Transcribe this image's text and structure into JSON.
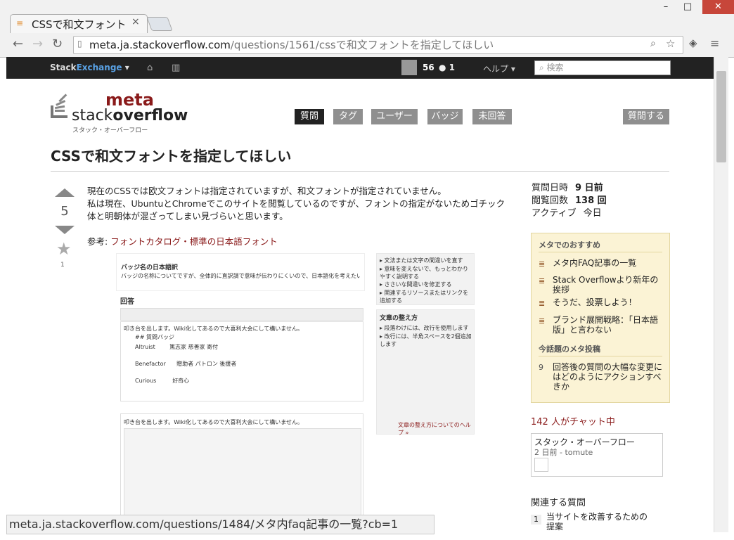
{
  "browser": {
    "tab_title": "CSSで和文フォント",
    "tab_close": "×",
    "url_host": "meta.ja.stackoverflow.com",
    "url_path": "/questions/1561/cssで和文フォントを指定してほしい",
    "status_url": "meta.ja.stackoverflow.com/questions/1484/メタ内faq記事の一覧?cb=1"
  },
  "topbar": {
    "brand_a": "Stack",
    "brand_b": "Exchange",
    "rep": "56",
    "badges": "● 1",
    "help": "ヘルプ ▾",
    "search_placeholder": "検索"
  },
  "logo": {
    "meta": "meta",
    "so_a": "stack",
    "so_b": "overflow",
    "sub": "スタック・オーバーフロー"
  },
  "nav": {
    "tabs": [
      "質問",
      "タグ",
      "ユーザー",
      "バッジ",
      "未回答"
    ],
    "ask": "質問する"
  },
  "question": {
    "title": "CSSで和文フォントを指定してほしい",
    "votes": "5",
    "favorites": "1",
    "line1": "現在のCSSでは欧文フォントは指定されていますが、和文フォントが指定されていません。",
    "line2": "私は現在、UbuntuとChromeでこのサイトを閲覧しているのですが、フォントの指定がないためゴチック体と明朝体が混ざってしまい見づらいと思います。",
    "ref_label": "参考:",
    "ref_link": "フォントカタログ・標準の日本語フォント"
  },
  "shot": {
    "h1": "バッジ名の日本語訳",
    "p1": "バッジの名称についてですが、全体的に直訳調で意味が伝わりにくいので、日本語化を考えたいと思っております。",
    "h2": "回答",
    "editor_l1": "叩き台を出します。Wiki化してあるので大喜利大会にして構いません。",
    "editor_l2": "## 質問バッジ",
    "editor_l3": "Altruist        篤志家 慈善家 寄付",
    "editor_l4": "Benefactor      贈助者 パトロン 後援者",
    "editor_l5": "Curious         好奇心",
    "preview_l1": "叩き台を出します。Wiki化してあるので大喜利大会にして構いません。",
    "side_h": "文章の整え方",
    "side_1": "▸ 文法または文字の間違いを直す",
    "side_2": "▸ 意味を変えないで、もっとわかりやすく説明する",
    "side_3": "▸ ささいな間違いを修正する",
    "side_4": "▸ 関連するリソースまたはリンクを追加する",
    "side_5": "▸ 段落わけには、改行を使用します",
    "side_6": "▸ 改行には、半角スペースを2個追加します",
    "side_7": "文章の整え方についてのヘルプ »"
  },
  "sidebar": {
    "asked_label": "質問日時",
    "asked_value": "9 日前",
    "viewed_label": "閲覧回数",
    "viewed_value": "138 回",
    "active_label": "アクティブ",
    "active_value": "今日",
    "rec_title": "メタでのおすすめ",
    "rec_items": [
      "メタ内FAQ記事の一覧",
      "Stack Overflowより新年の挨拶",
      "そうだ、投票しよう！",
      "ブランド展開戦略：「日本語版」と言わない"
    ],
    "hot_title": "今話題のメタ投稿",
    "hot_count": "9",
    "hot_item": "回答後の質問の大幅な変更にはどのようにアクションすべきか",
    "chat": "142 人がチャット中",
    "chat_room": "スタック・オーバーフロー",
    "chat_meta": "2 日前 - tomute",
    "related": "関連する質問",
    "related_count": "1",
    "related_item": "当サイトを改善するための提案"
  }
}
